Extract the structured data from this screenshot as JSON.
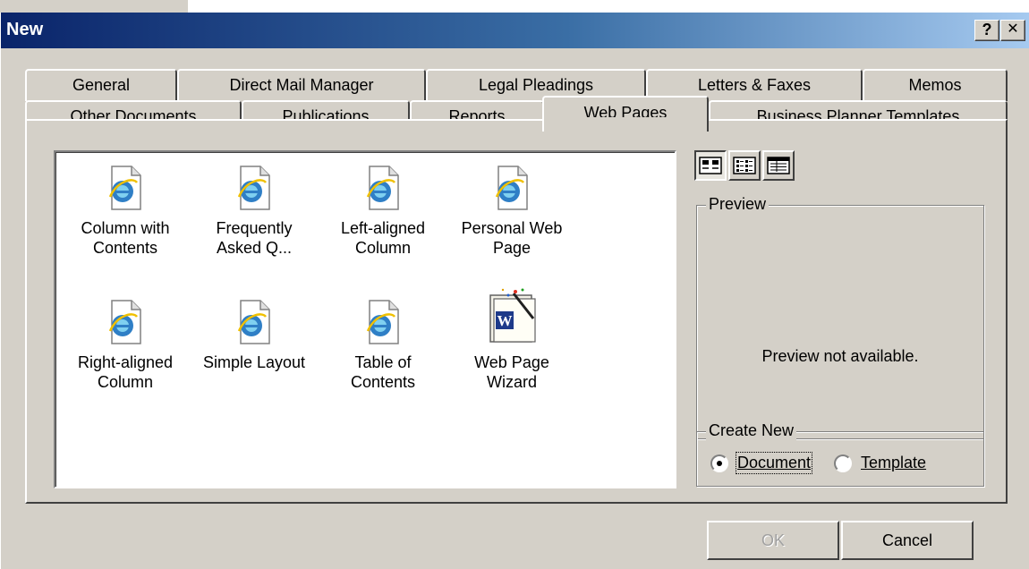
{
  "window": {
    "title": "New",
    "help_label": "?",
    "close_label": "✕"
  },
  "tabs": {
    "back_row": [
      "General",
      "Direct Mail Manager",
      "Legal Pleadings",
      "Letters & Faxes",
      "Memos"
    ],
    "front_row": [
      "Other Documents",
      "Publications",
      "Reports",
      "Web Pages",
      "Business Planner Templates"
    ],
    "active": "Web Pages"
  },
  "templates": [
    {
      "label_line1": "Column with",
      "label_line2": "Contents",
      "icon": "ie-document-icon"
    },
    {
      "label_line1": "Frequently",
      "label_line2": "Asked Q...",
      "icon": "ie-document-icon"
    },
    {
      "label_line1": "Left-aligned",
      "label_line2": "Column",
      "icon": "ie-document-icon"
    },
    {
      "label_line1": "Personal Web",
      "label_line2": "Page",
      "icon": "ie-document-icon"
    },
    {
      "label_line1": "Right-aligned",
      "label_line2": "Column",
      "icon": "ie-document-icon"
    },
    {
      "label_line1": "Simple Layout",
      "label_line2": "",
      "icon": "ie-document-icon"
    },
    {
      "label_line1": "Table of",
      "label_line2": "Contents",
      "icon": "ie-document-icon"
    },
    {
      "label_line1": "Web Page",
      "label_line2": "Wizard",
      "icon": "word-wizard-icon"
    }
  ],
  "view_buttons": [
    "large-icons-view-icon",
    "list-view-icon",
    "details-view-icon"
  ],
  "preview": {
    "label": "Preview",
    "message": "Preview not available."
  },
  "create_new": {
    "label": "Create New",
    "document_label": "Document",
    "template_label": "Template",
    "selected": "Document"
  },
  "buttons": {
    "ok": "OK",
    "cancel": "Cancel",
    "ok_enabled": false
  }
}
